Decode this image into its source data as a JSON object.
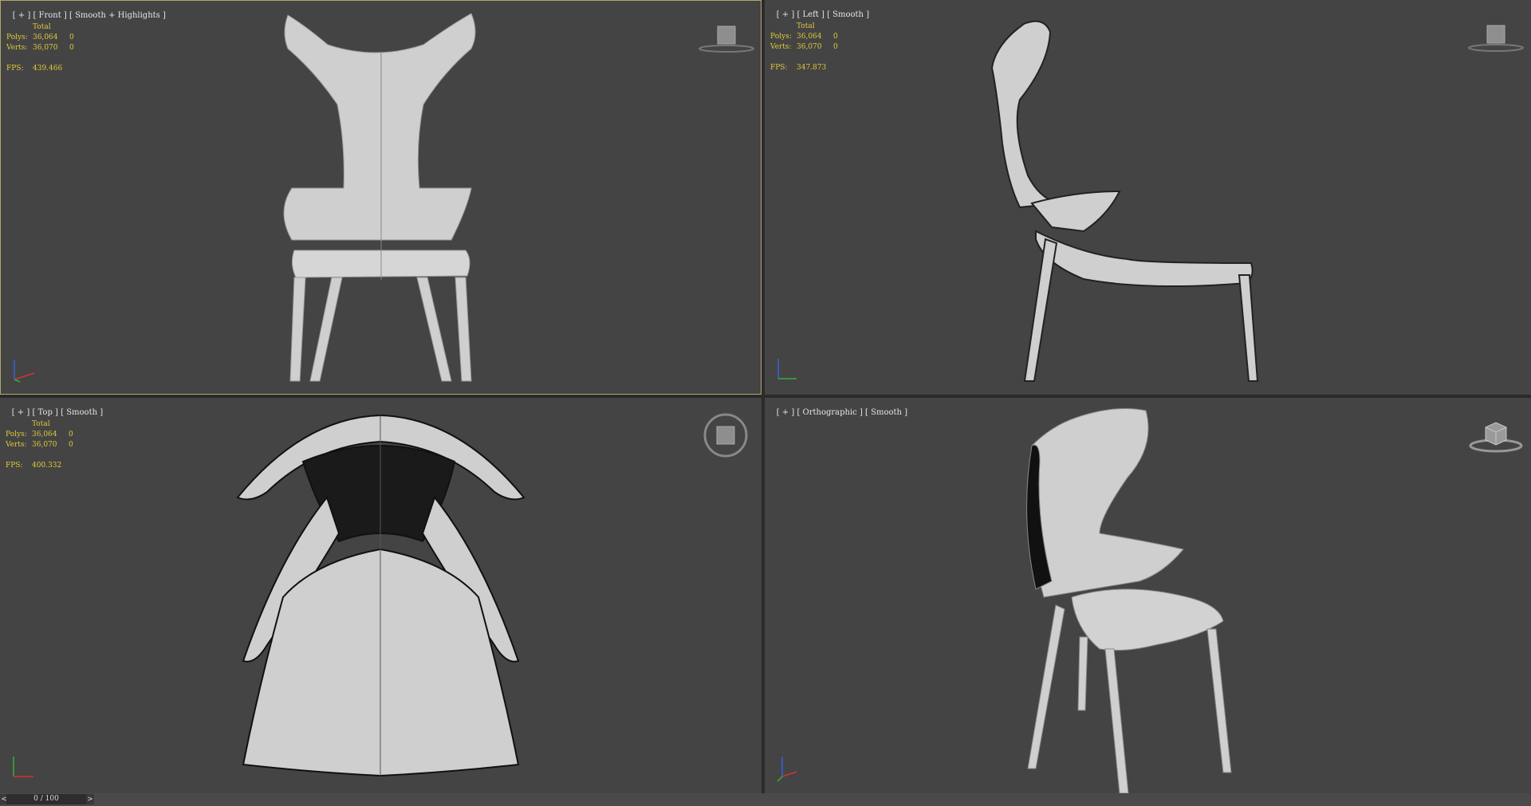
{
  "viewports": [
    {
      "id": "front",
      "label": {
        "plus": "[ + ]",
        "view": "Front",
        "shading": "Smooth + Highlights ]"
      },
      "stats": {
        "total": "Total",
        "polys_label": "Polys:",
        "polys": "36,064",
        "polys_sel": "0",
        "verts_label": "Verts:",
        "verts": "36,070",
        "verts_sel": "0",
        "fps_label": "FPS:",
        "fps": "439.466"
      },
      "viewcube_icon": "front-viewcube-icon",
      "active": true
    },
    {
      "id": "left",
      "label": {
        "plus": "[ + ]",
        "view": "Left",
        "shading": "Smooth ]"
      },
      "stats": {
        "total": "Total",
        "polys_label": "Polys:",
        "polys": "36,064",
        "polys_sel": "0",
        "verts_label": "Verts:",
        "verts": "36,070",
        "verts_sel": "0",
        "fps_label": "FPS:",
        "fps": "347.873"
      },
      "viewcube_icon": "left-viewcube-icon",
      "active": false
    },
    {
      "id": "top",
      "label": {
        "plus": "[ + ]",
        "view": "Top",
        "shading": "Smooth ]"
      },
      "stats": {
        "total": "Total",
        "polys_label": "Polys:",
        "polys": "36,064",
        "polys_sel": "0",
        "verts_label": "Verts:",
        "verts": "36,070",
        "verts_sel": "0",
        "fps_label": "FPS:",
        "fps": "400.332"
      },
      "viewcube_icon": "top-viewcube-icon",
      "active": false
    },
    {
      "id": "ortho",
      "label": {
        "plus": "[ + ]",
        "view": "Orthographic",
        "shading": "Smooth ]"
      },
      "stats": null,
      "viewcube_icon": "perspective-viewcube-icon",
      "active": false
    }
  ],
  "timebar": {
    "prev": "<",
    "next": ">",
    "frame": "0 / 100"
  },
  "colors": {
    "viewport_bg": "#444444",
    "active_border": "#b3a76a",
    "stats_text": "#e1c93a",
    "model": "#cfcfcf"
  }
}
